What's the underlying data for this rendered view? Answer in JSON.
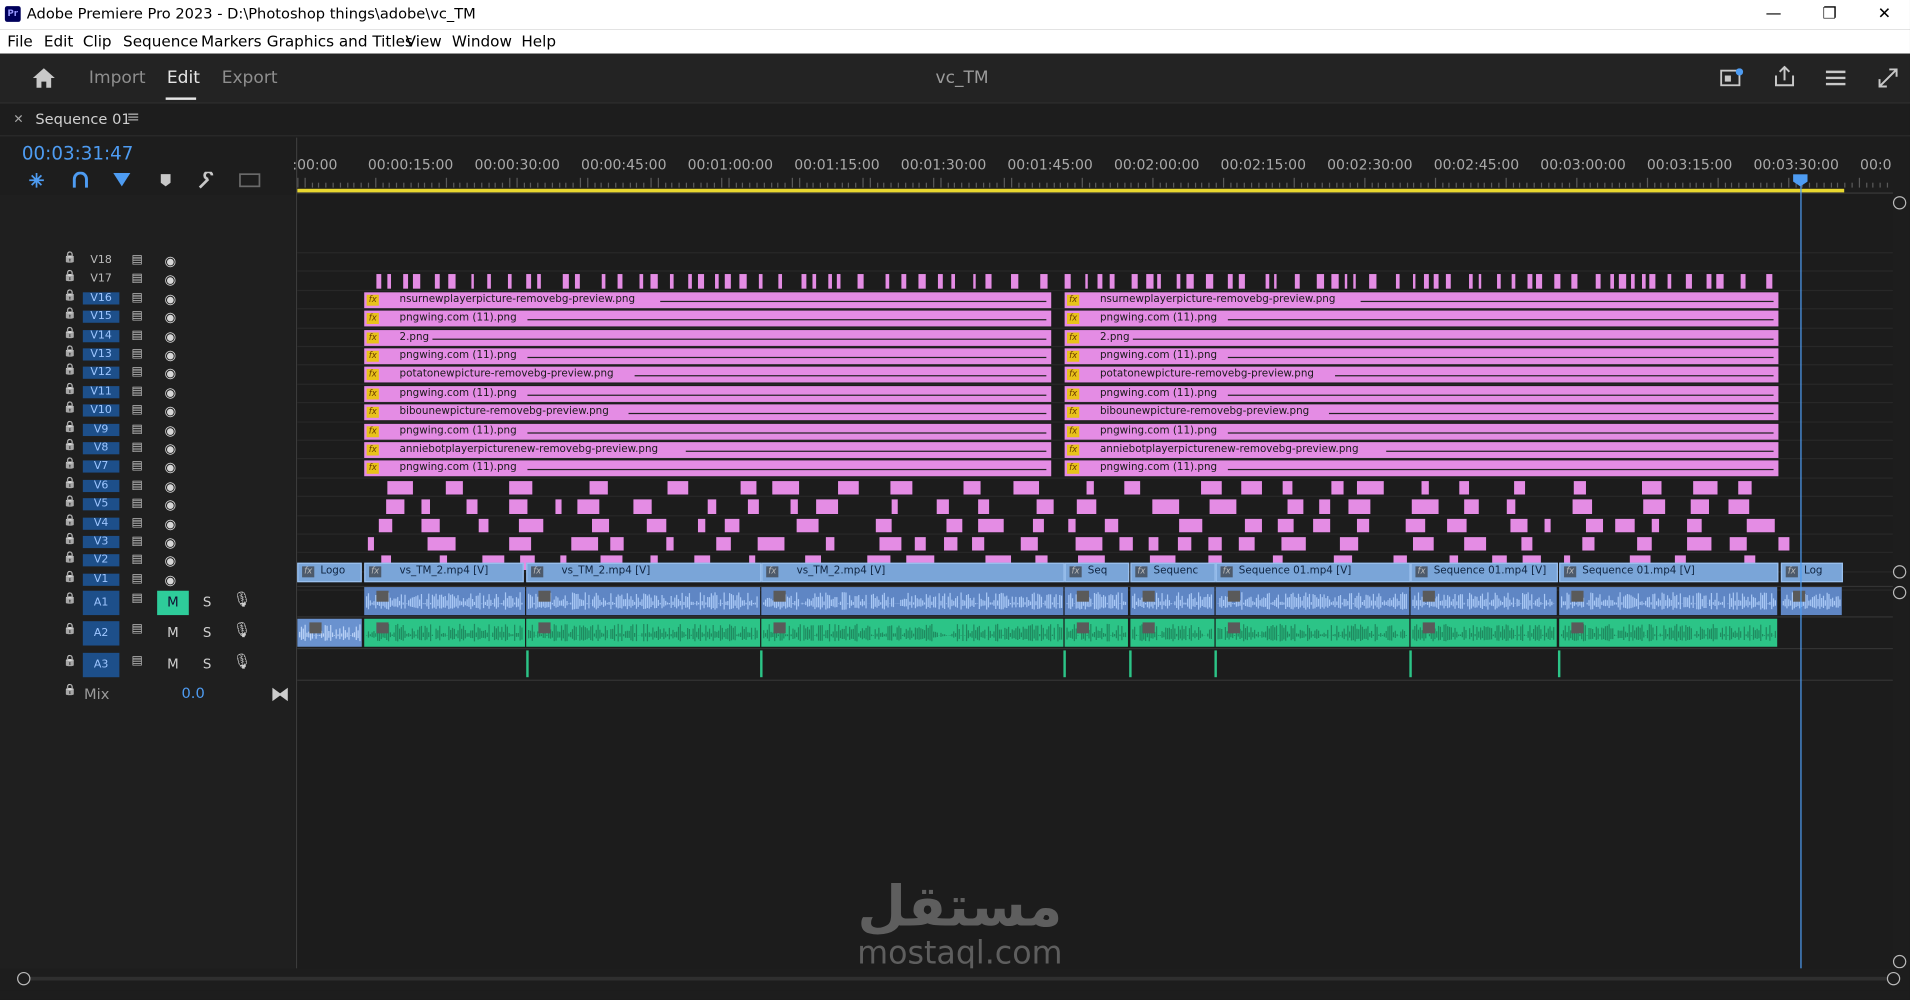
{
  "window": {
    "app_title": "Adobe Premiere Pro 2023 - D:\\Photoshop things\\adobe\\vc_TM",
    "minimize_label": "—",
    "maximize_label": "❐",
    "close_label": "✕"
  },
  "menubar": {
    "items": [
      "File",
      "Edit",
      "Clip",
      "Sequence",
      "Markers",
      "Graphics and Titles",
      "View",
      "Window",
      "Help"
    ]
  },
  "header": {
    "tabs": [
      "Import",
      "Edit",
      "Export"
    ],
    "active_tab": "Edit",
    "project_title": "vc_TM"
  },
  "sequence": {
    "name": "Sequence 01",
    "timecode": "00:03:31:47",
    "ruler_labels": [
      ":00:00",
      "00:00:15:00",
      "00:00:30:00",
      "00:00:45:00",
      "00:01:00:00",
      "00:01:15:00",
      "00:01:30:00",
      "00:01:45:00",
      "00:02:00:00",
      "00:02:15:00",
      "00:02:30:00",
      "00:02:45:00",
      "00:03:00:00",
      "00:03:15:00",
      "00:03:30:00",
      "00:0"
    ]
  },
  "tracks": {
    "video": [
      "V18",
      "V17",
      "V16",
      "V15",
      "V14",
      "V13",
      "V12",
      "V11",
      "V10",
      "V9",
      "V8",
      "V7",
      "V6",
      "V5",
      "V4",
      "V3",
      "V2",
      "V1"
    ],
    "audio": [
      "A1",
      "A2",
      "A3"
    ],
    "mute_label": "M",
    "solo_label": "S",
    "mix_label": "Mix",
    "mix_value": "0.0"
  },
  "graphic_clips": [
    "nsurnewplayerpicture-removebg-preview.png",
    "pngwing.com (11).png",
    "2.png",
    "pngwing.com (11).png",
    "potatonewpicture-removebg-preview.png",
    "pngwing.com (11).png",
    "bibounewpicture-removebg-preview.png",
    "pngwing.com (11).png",
    "anniebotplayerpicturenew-removebg-preview.png",
    "pngwing.com (11).png"
  ],
  "v1_clips": [
    "Logo",
    "vs_TM_2.mp4 [V]",
    "vs_TM_2.mp4 [V]",
    "vs_TM_2.mp4 [V]",
    "Seq",
    "Sequenc",
    "Sequence 01.mp4 [V]",
    "Sequence 01.mp4 [V]",
    "Sequence 01.mp4 [V]",
    "Log"
  ],
  "fx_label": "fx",
  "watermark": {
    "arabic": "مستقل",
    "latin": "mostaql.com"
  },
  "colors": {
    "graphic_clip": "#e48ce4",
    "video_clip": "#7aa5d8",
    "audio_a1": "#5f86c4",
    "audio_a2": "#2cc487",
    "playhead": "#4e9cf2",
    "work_area": "#e8d72f"
  },
  "icons": [
    "home-icon",
    "ripple-icon",
    "snap-icon",
    "linked-selection-icon",
    "marker-icon",
    "wrench-icon",
    "captions-icon",
    "lock-icon",
    "sync-lock-icon",
    "eye-icon",
    "mic-icon",
    "quick-export-icon",
    "share-icon",
    "workspace-icon",
    "fullscreen-icon"
  ]
}
